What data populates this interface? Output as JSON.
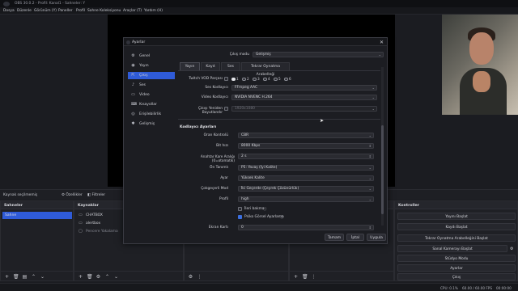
{
  "window": {
    "title": "OBS 30.0.2 - Profil: Kanal1 - Sahneler: Y"
  },
  "menubar": [
    "Dosya",
    "Düzenle",
    "Görünüm (Y)",
    "Paneller",
    "Profil",
    "Sahne Koleksiyonu",
    "Araçlar (T)",
    "Yardım (H)"
  ],
  "source_bar": {
    "label": "Kaynak seçilmemiş",
    "properties": "Özellikler",
    "filters": "Filtreler"
  },
  "docks": {
    "scenes": {
      "title": "Sahneler",
      "items": [
        "Sahne"
      ]
    },
    "sources": {
      "title": "Kaynaklar",
      "items": [
        {
          "name": "CHATBOX",
          "icon": "browser-icon"
        },
        {
          "name": "alertbox",
          "icon": "browser-icon"
        },
        {
          "name": "Pencere Yakalama",
          "icon": "window-capture-icon"
        }
      ]
    },
    "controls": {
      "title": "Kontroller",
      "buttons": [
        "Yayını Başlat",
        "Kaydı Başlat",
        "Tekrar Oynatma Arabelleğini Başlat",
        "Sanal Kamerayı Başlat",
        "Stüdyo Modu",
        "Ayarlar",
        "Çıkış"
      ]
    }
  },
  "dialog": {
    "title": "Ayarlar",
    "nav": [
      {
        "label": "Genel",
        "icon": "gear-icon"
      },
      {
        "label": "Yayın",
        "icon": "broadcast-icon"
      },
      {
        "label": "Çıkış",
        "icon": "output-icon",
        "selected": true
      },
      {
        "label": "Ses",
        "icon": "audio-icon"
      },
      {
        "label": "Video",
        "icon": "video-icon"
      },
      {
        "label": "Kısayollar",
        "icon": "keyboard-icon"
      },
      {
        "label": "Erişilebilirlik",
        "icon": "accessibility-icon"
      },
      {
        "label": "Gelişmiş",
        "icon": "wrench-icon"
      }
    ],
    "output_mode_label": "Çıkış modu",
    "output_mode_value": "Gelişmiş",
    "tabs": [
      "Yayın",
      "Kayıt",
      "Ses",
      "Tekrar Oynatma Arabelleği"
    ],
    "twitch_vod_label": "Twitch VOD Parçası",
    "twitch_tracks": [
      "1",
      "2",
      "3",
      "4",
      "5",
      "6"
    ],
    "audio_encoder_label": "Ses Kodlayıcı",
    "audio_encoder_value": "FFmpeg AAC",
    "video_encoder_label": "Video Kodlayıcı",
    "video_encoder_value": "NVIDIA NVENC H.264",
    "rescale_label": "Çıkışı Yeniden Boyutlandır",
    "rescale_value": "1920x1080",
    "encoder_settings_title": "Kodlayıcı Ayarları",
    "fields": [
      {
        "label": "Oran Kontrolü",
        "value": "CBR"
      },
      {
        "label": "Bit hızı",
        "value": "8000 Kbps"
      },
      {
        "label": "Anahtar Kare Aralığı (0=otomatik)",
        "value": "2 s"
      },
      {
        "label": "Ön Tanımlı",
        "value": "P5: Yavaş (İyi Kalite)"
      },
      {
        "label": "Ayar",
        "value": "Yüksek Kalite"
      },
      {
        "label": "Çokgeçerli Mod",
        "value": "İki Geçerde (Çeyrek Çözünürlük)"
      },
      {
        "label": "Profil",
        "value": "high"
      }
    ],
    "checkboxes": [
      {
        "label": "İleri bakma",
        "checked": false
      },
      {
        "label": "Psiko Görsel Ayarlama",
        "checked": true
      }
    ],
    "b_frames_label": "Ekran Kartı",
    "b_frames_value": "0",
    "buttons": {
      "ok": "Tamam",
      "cancel": "İptal",
      "apply": "Uygula"
    }
  },
  "status": {
    "cpu": "CPU: 0.1%",
    "fps": "60.00 / 60.00 FPS",
    "time": "00:00:00"
  }
}
